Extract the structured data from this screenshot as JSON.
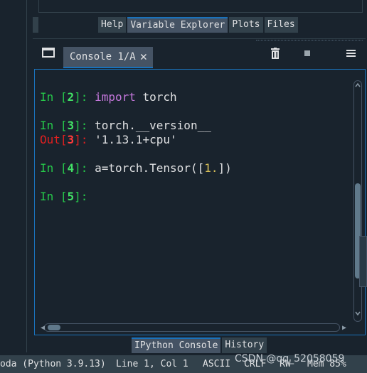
{
  "top_tabs": [
    {
      "label": "Help",
      "active": false
    },
    {
      "label": "Variable Explorer",
      "active": true
    },
    {
      "label": "Plots",
      "active": false
    },
    {
      "label": "Files",
      "active": false
    }
  ],
  "console_tab": {
    "label": "Console 1/A",
    "close": "✕"
  },
  "console": {
    "lines": [
      {
        "prompt_word": "In",
        "prompt_open": " [",
        "prompt_num": "2",
        "prompt_close": "]: ",
        "kw": "import",
        "code": " torch"
      },
      {
        "prompt_word": "In",
        "prompt_open": " [",
        "prompt_num": "3",
        "prompt_close": "]: ",
        "code": "torch.__version__"
      },
      {
        "prompt_word": "Out",
        "prompt_open": "[",
        "prompt_num": "3",
        "prompt_close": "]: ",
        "code": "'1.13.1+cpu'"
      },
      {
        "prompt_word": "In",
        "prompt_open": " [",
        "prompt_num": "4",
        "prompt_close": "]: ",
        "code_a": "a=torch.Tensor([",
        "num": "1.",
        "code_b": "])"
      },
      {
        "prompt_word": "In",
        "prompt_open": " [",
        "prompt_num": "5",
        "prompt_close": "]: "
      }
    ]
  },
  "bottom_tabs": [
    {
      "label": "IPython Console",
      "active": true
    },
    {
      "label": "History",
      "active": false
    }
  ],
  "status_bar": {
    "interpreter": "oda (Python 3.9.13)",
    "position": "Line 1, Col 1",
    "encoding": "ASCII",
    "eol": "CRLF",
    "permissions": "RW",
    "memory": "Mem 85%"
  },
  "watermark": "CSDN @qq_52058059",
  "colors": {
    "accent": "#1a72bb",
    "prompt_in": "#26c94a",
    "prompt_out": "#e02020",
    "keyword": "#c678dd",
    "number": "#d8c058"
  }
}
